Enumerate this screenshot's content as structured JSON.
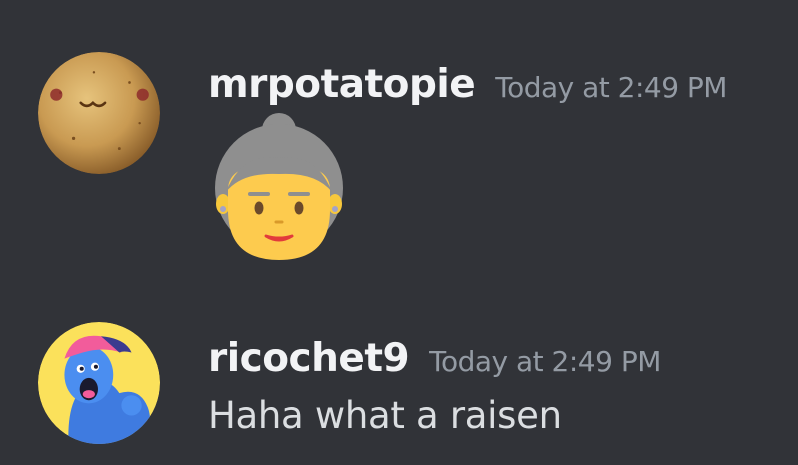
{
  "messages": [
    {
      "username": "mrpotatopie",
      "timestamp": "Today at 2:49 PM",
      "avatar_icon": "potato-cookie-avatar",
      "emoji_icon": "older-woman-emoji",
      "text": ""
    },
    {
      "username": "ricochet9",
      "timestamp": "Today at 2:49 PM",
      "avatar_icon": "blue-cartoon-character-avatar",
      "text": "Haha what a raisen"
    }
  ],
  "colors": {
    "background": "#313338",
    "username": "#f2f3f5",
    "timestamp": "#949ba4",
    "message_text": "#dbdee1"
  }
}
